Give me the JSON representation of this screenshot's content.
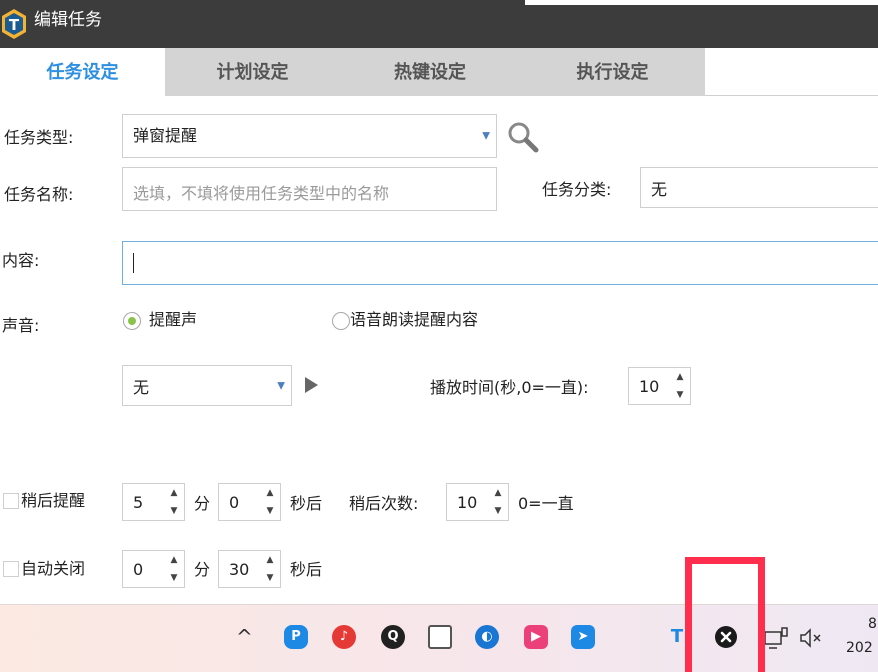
{
  "window": {
    "title": "编辑任务"
  },
  "tabs": [
    {
      "label": "任务设定",
      "active": true
    },
    {
      "label": "计划设定",
      "active": false
    },
    {
      "label": "热键设定",
      "active": false
    },
    {
      "label": "执行设定",
      "active": false
    }
  ],
  "form": {
    "task_type_label": "任务类型:",
    "task_type_value": "弹窗提醒",
    "task_name_label": "任务名称:",
    "task_name_placeholder": "选填，不填将使用任务类型中的名称",
    "category_label": "任务分类:",
    "category_value": "无",
    "content_label": "内容:",
    "content_value": "",
    "sound_label": "声音:",
    "radio_beep_label": "提醒声",
    "radio_tts_label": "语音朗读提醒内容",
    "sound_select_value": "无",
    "play_time_label": "播放时间(秒,0=一直):",
    "play_time_value": "10",
    "snooze_label": "稍后提醒",
    "snooze_minutes": "5",
    "minute_unit": "分",
    "snooze_seconds": "0",
    "seconds_after": "秒后",
    "snooze_count_label": "稍后次数:",
    "snooze_count_value": "10",
    "snooze_count_hint": "0=一直",
    "autoclose_label": "自动关闭",
    "autoclose_minutes": "0",
    "autoclose_seconds": "30"
  },
  "taskbar": {
    "chevron": "^",
    "clock_fragment_top": "8",
    "clock_fragment_bottom": "202",
    "icons": [
      "chevron-up-icon",
      "lanxin-icon",
      "netease-music-icon",
      "qq-icon",
      "window-icon",
      "photo-icon",
      "video-icon",
      "feishu-icon",
      "tray-logo-icon",
      "close-circle-icon",
      "network-icon",
      "volume-mute-icon"
    ]
  },
  "colors": {
    "accent": "#2f8fe0",
    "radio_on": "#8ac34a",
    "highlight": "#ff2e4c"
  }
}
